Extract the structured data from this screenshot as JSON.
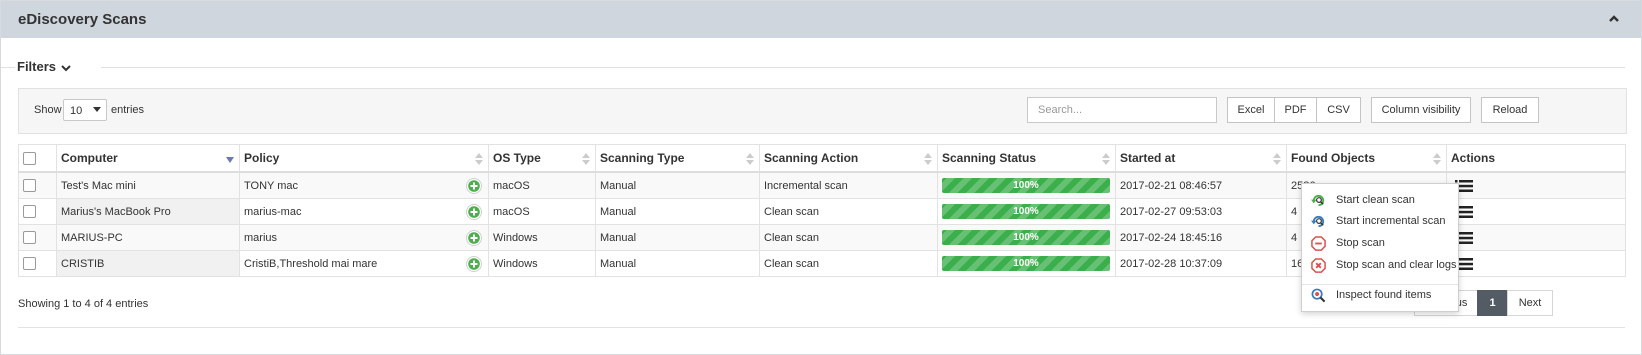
{
  "panel": {
    "title": "eDiscovery Scans",
    "collapse_icon": "chevron-up-icon"
  },
  "filters": {
    "label": "Filters",
    "toggle_icon": "chevron-down-icon"
  },
  "toolbar": {
    "show_label": "Show",
    "entries_value": "10",
    "entries_label": "entries",
    "search_placeholder": "Search...",
    "buttons": {
      "excel": "Excel",
      "pdf": "PDF",
      "csv": "CSV",
      "column_visibility": "Column visibility",
      "reload": "Reload"
    }
  },
  "table": {
    "columns": [
      "Computer",
      "Policy",
      "OS Type",
      "Scanning Type",
      "Scanning Action",
      "Scanning Status",
      "Started at",
      "Found Objects",
      "Actions"
    ],
    "rows": [
      {
        "computer": "Test's Mac mini",
        "policy": "TONY mac",
        "os": "macOS",
        "scan_type": "Manual",
        "scan_action": "Incremental scan",
        "status": "100%",
        "progress": 1.0,
        "started": "2017-02-21 08:46:57",
        "found": "2586"
      },
      {
        "computer": "Marius's MacBook Pro",
        "policy": "marius-mac",
        "os": "macOS",
        "scan_type": "Manual",
        "scan_action": "Clean scan",
        "status": "100%",
        "progress": 1.0,
        "started": "2017-02-27 09:53:03",
        "found": "4"
      },
      {
        "computer": "MARIUS-PC",
        "policy": "marius",
        "os": "Windows",
        "scan_type": "Manual",
        "scan_action": "Clean scan",
        "status": "100%",
        "progress": 1.0,
        "started": "2017-02-24 18:45:16",
        "found": "4"
      },
      {
        "computer": "CRISTIB",
        "policy": "CristiB,Threshold mai mare",
        "os": "Windows",
        "scan_type": "Manual",
        "scan_action": "Clean scan",
        "status": "100%",
        "progress": 1.0,
        "started": "2017-02-28 10:37:09",
        "found": "16"
      }
    ]
  },
  "footer": {
    "info": "Showing 1 to 4 of 4 entries",
    "pagination": {
      "previous": "Previous",
      "page": "1",
      "next": "Next"
    }
  },
  "actions_menu": {
    "items": [
      {
        "label": "Start clean scan",
        "icon": "refresh-magnifier-icon"
      },
      {
        "label": "Start incremental scan",
        "icon": "refresh-magnifier-icon"
      },
      {
        "label": "Stop scan",
        "icon": "stop-minus-icon"
      },
      {
        "label": "Stop scan and clear logs",
        "icon": "stop-x-icon"
      },
      {
        "label": "Inspect found items",
        "icon": "inspect-magnifier-icon"
      }
    ]
  },
  "colors": {
    "header_bg": "#cfd6de",
    "progress_green": "#3caf4d",
    "plus_green": "#4cae4c",
    "stop_red": "#d9534f",
    "active_page": "#535b65"
  }
}
